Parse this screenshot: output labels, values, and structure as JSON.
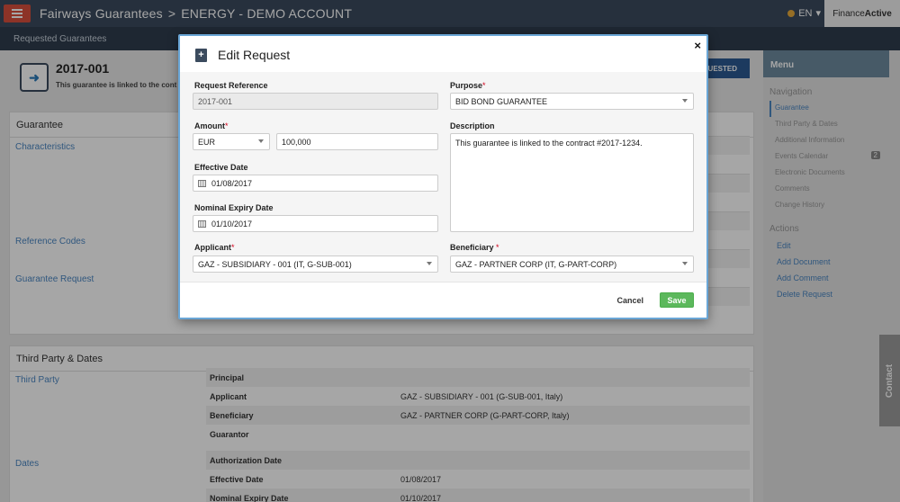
{
  "topbar": {
    "app_name": "Fairways Guarantees",
    "separator": ">",
    "account": "ENERGY - DEMO ACCOUNT",
    "lang": "EN",
    "lang_caret": "▾",
    "brand_a": "Finance",
    "brand_b": "Active"
  },
  "subbar": {
    "label": "Requested Guarantees"
  },
  "header": {
    "reference": "2017-001",
    "linked_text": "This guarantee is linked to the cont",
    "status_button": "UESTED"
  },
  "guarantee_panel": {
    "title": "Guarantee",
    "sections": [
      "Characteristics",
      "Reference Codes",
      "Guarantee Request"
    ]
  },
  "third_party_panel": {
    "title": "Third Party & Dates",
    "third_party_label": "Third Party",
    "dates_label": "Dates",
    "rows": [
      {
        "key": "Principal",
        "value": ""
      },
      {
        "key": "Applicant",
        "value": "GAZ - SUBSIDIARY - 001 (G-SUB-001, Italy)"
      },
      {
        "key": "Beneficiary",
        "value": "GAZ - PARTNER CORP (G-PART-CORP, Italy)"
      },
      {
        "key": "Guarantor",
        "value": ""
      },
      {
        "key": "Authorization Date",
        "value": ""
      },
      {
        "key": "Effective Date",
        "value": "01/08/2017"
      },
      {
        "key": "Nominal Expiry Date",
        "value": "01/10/2017"
      }
    ]
  },
  "sidebar": {
    "menu_title": "Menu",
    "nav_title": "Navigation",
    "nav_items": [
      "Guarantee",
      "Third Party & Dates",
      "Additional Information",
      "Events Calendar",
      "Electronic Documents",
      "Comments",
      "Change History"
    ],
    "events_badge": "2",
    "actions_title": "Actions",
    "actions": [
      "Edit",
      "Add Document",
      "Add Comment",
      "Delete Request"
    ],
    "contact": "Contact"
  },
  "modal": {
    "title": "Edit Request",
    "close": "×",
    "icon": "+",
    "request_reference": {
      "label": "Request Reference",
      "value": "2017-001"
    },
    "purpose": {
      "label": "Purpose",
      "value": "BID BOND GUARANTEE"
    },
    "amount": {
      "label": "Amount",
      "currency": "EUR",
      "value": "100,000"
    },
    "description": {
      "label": "Description",
      "value": "This guarantee is linked to the contract #2017-1234."
    },
    "effective_date": {
      "label": "Effective Date",
      "value": "01/08/2017"
    },
    "nominal_expiry_date": {
      "label": "Nominal Expiry Date",
      "value": "01/10/2017"
    },
    "applicant": {
      "label": "Applicant",
      "value": "GAZ - SUBSIDIARY - 001 (IT, G-SUB-001)"
    },
    "beneficiary": {
      "label": "Beneficiary",
      "value": "GAZ - PARTNER CORP (IT, G-PART-CORP)"
    },
    "required_mark": "*",
    "cancel": "Cancel",
    "save": "Save"
  },
  "colors": {
    "topbar": "#3b4b5e",
    "accent": "#4a86c2",
    "save": "#5cb85c",
    "menu_button": "#d94f3d"
  }
}
